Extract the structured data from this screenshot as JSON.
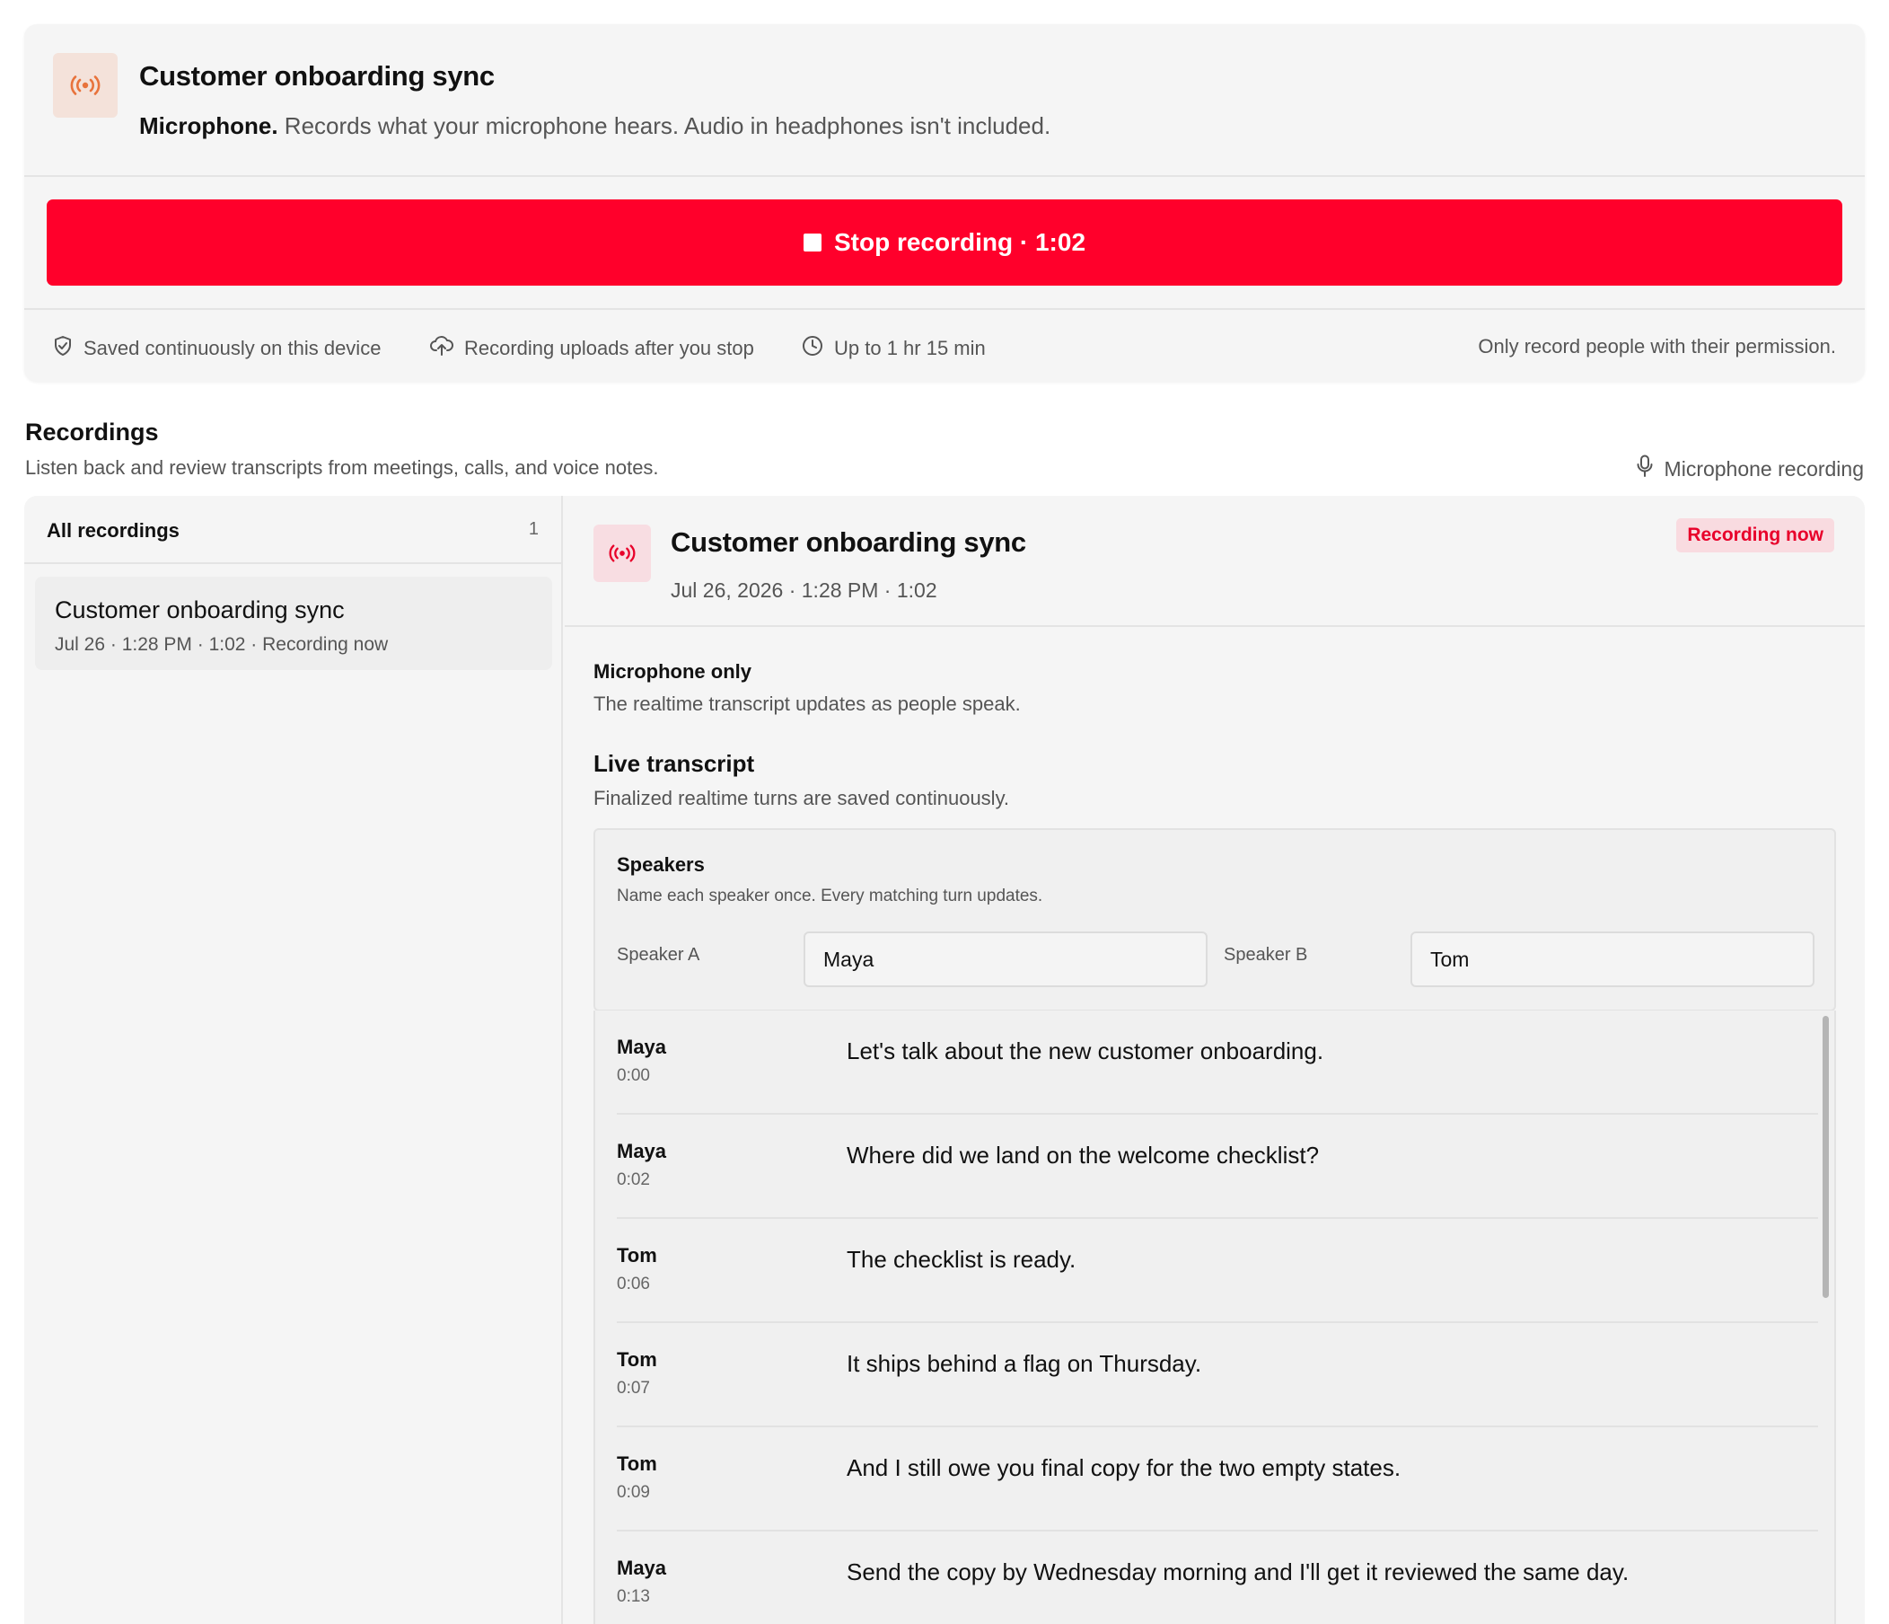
{
  "recorder": {
    "title": "Customer onboarding sync",
    "source_label": "Microphone.",
    "source_desc": "Records what your microphone hears. Audio in headphones isn't included.",
    "stop_label": "Stop recording · 1:02",
    "saved_note": "Saved continuously on this device",
    "upload_note": "Recording uploads after you stop",
    "limit_note": "Up to 1 hr 15 min",
    "permission_note": "Only record people with their permission."
  },
  "recordings": {
    "title": "Recordings",
    "subtitle": "Listen back and review transcripts from meetings, calls, and voice notes.",
    "mode_label": "Microphone recording"
  },
  "sidebar": {
    "header": "All recordings",
    "count": "1",
    "items": [
      {
        "title": "Customer onboarding sync",
        "meta": "Jul 26 · 1:28 PM · 1:02 · Recording now"
      }
    ]
  },
  "detail": {
    "title": "Customer onboarding sync",
    "meta": "Jul 26, 2026 · 1:28 PM · 1:02",
    "badge": "Recording now",
    "mode_title": "Microphone only",
    "mode_sub": "The realtime transcript updates as people speak.",
    "live_title": "Live transcript",
    "live_sub": "Finalized realtime turns are saved continuously."
  },
  "speakers": {
    "title": "Speakers",
    "subtitle": "Name each speaker once. Every matching turn updates.",
    "a_label": "Speaker A",
    "a_value": "Maya",
    "b_label": "Speaker B",
    "b_value": "Tom"
  },
  "transcript": [
    {
      "speaker": "Maya",
      "time": "0:00",
      "text": "Let's talk about the new customer onboarding."
    },
    {
      "speaker": "Maya",
      "time": "0:02",
      "text": "Where did we land on the welcome checklist?"
    },
    {
      "speaker": "Tom",
      "time": "0:06",
      "text": "The checklist is ready."
    },
    {
      "speaker": "Tom",
      "time": "0:07",
      "text": "It ships behind a flag on Thursday."
    },
    {
      "speaker": "Tom",
      "time": "0:09",
      "text": "And I still owe you final copy for the two empty states."
    },
    {
      "speaker": "Maya",
      "time": "0:13",
      "text": "Send the copy by Wednesday morning and I'll get it reviewed the same day."
    }
  ],
  "colors": {
    "accent_red": "#ff002b",
    "source_icon_orange": "#e8733c",
    "badge_red": "#e8002a"
  },
  "icons": {
    "source": "broadcast-icon",
    "saved": "shield-check-icon",
    "upload": "cloud-upload-icon",
    "limit": "clock-icon",
    "mic": "microphone-icon"
  }
}
